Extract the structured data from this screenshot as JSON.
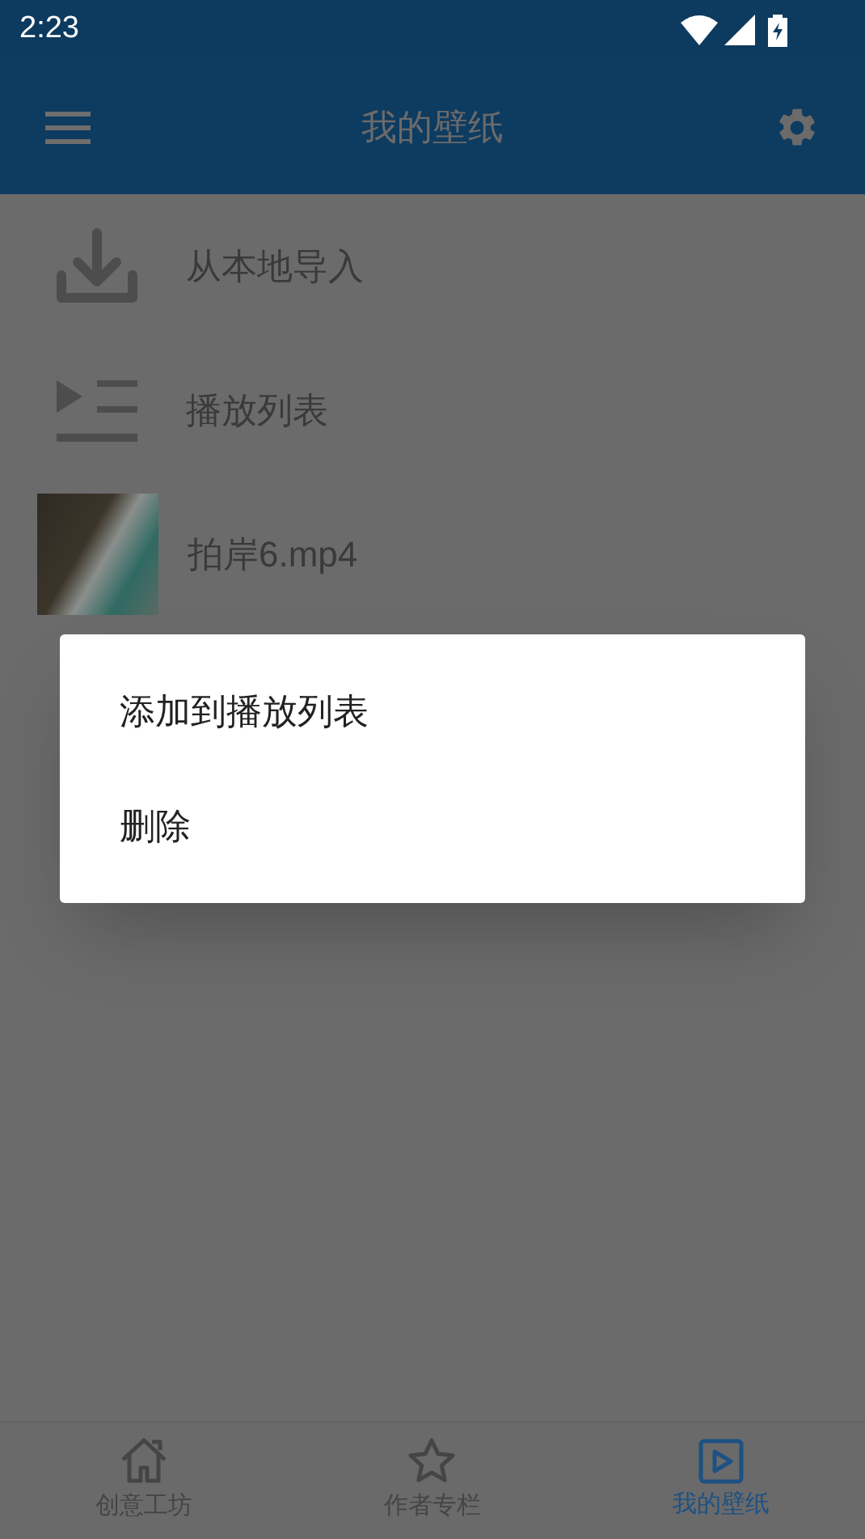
{
  "status_bar": {
    "time": "2:23"
  },
  "app_bar": {
    "title": "我的壁纸"
  },
  "list": {
    "items": [
      {
        "kind": "import",
        "label": "从本地导入"
      },
      {
        "kind": "playlist",
        "label": "播放列表"
      },
      {
        "kind": "video",
        "label": "拍岸6.mp4"
      }
    ]
  },
  "dialog": {
    "options": [
      "添加到播放列表",
      "删除"
    ]
  },
  "bottom_nav": {
    "tabs": [
      {
        "kind": "home",
        "label": "创意工坊",
        "selected": false
      },
      {
        "kind": "star",
        "label": "作者专栏",
        "selected": false
      },
      {
        "kind": "play",
        "label": "我的壁纸",
        "selected": true
      }
    ]
  }
}
